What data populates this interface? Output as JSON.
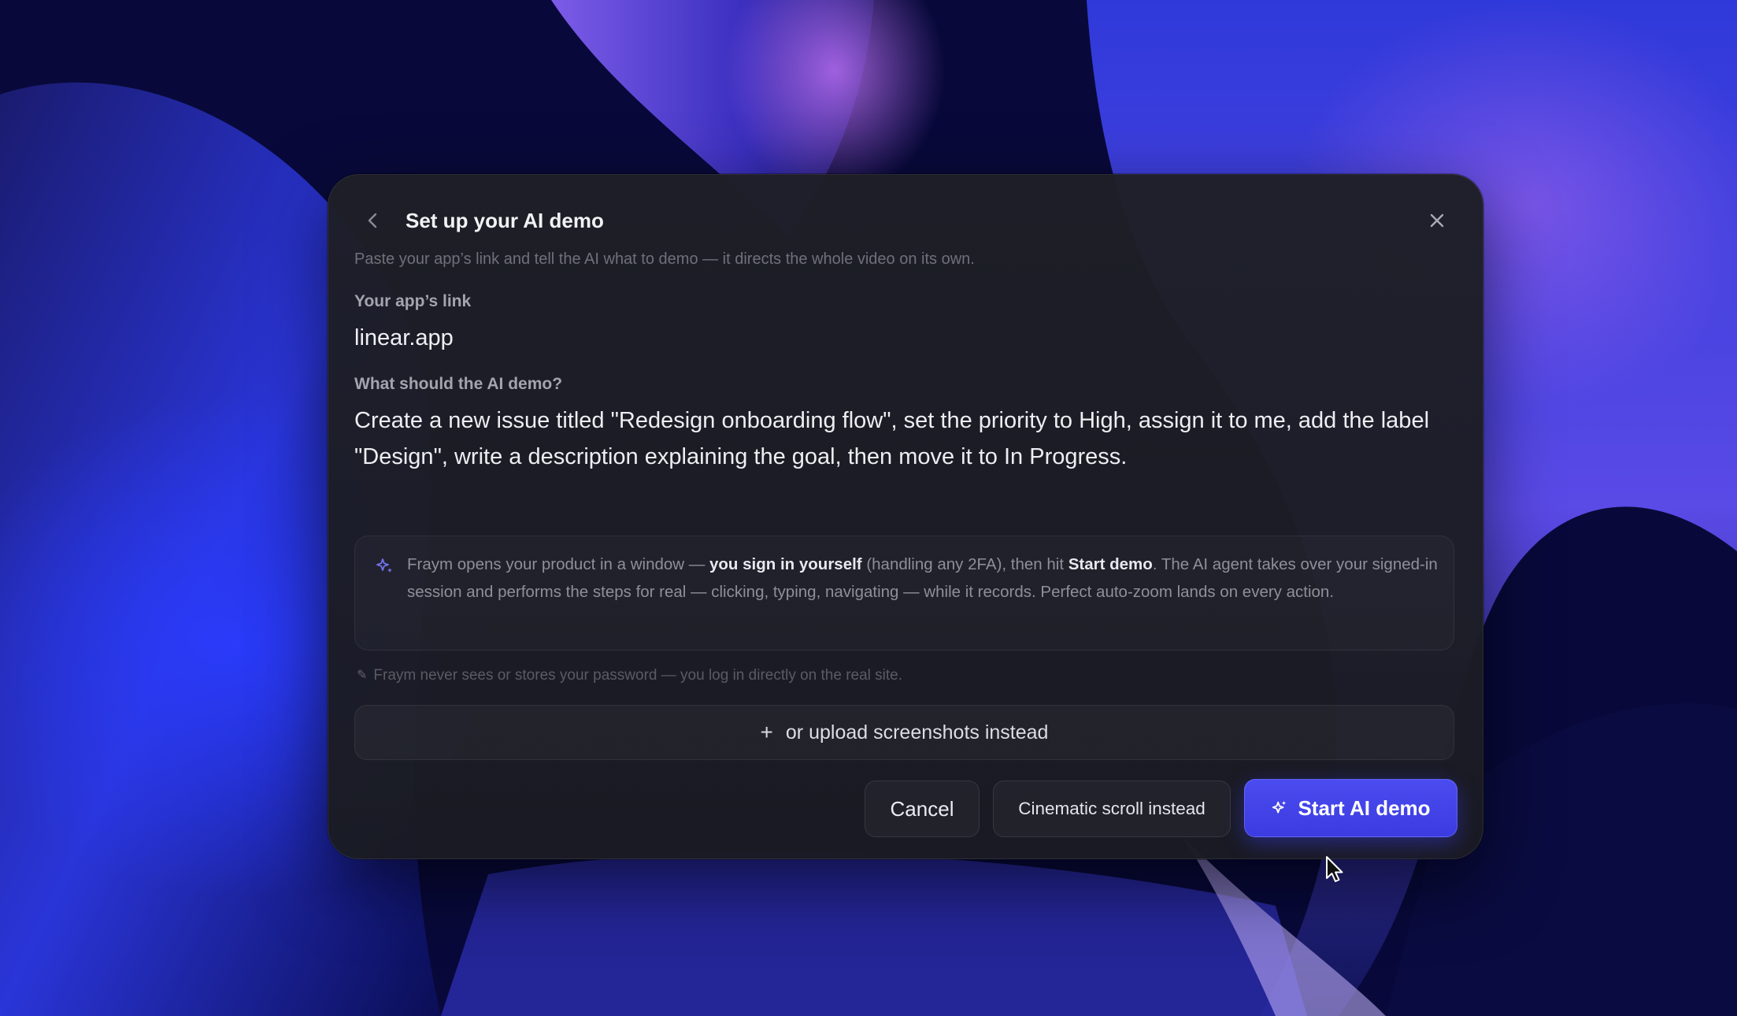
{
  "dialog": {
    "title": "Set up your AI demo",
    "subtitle": "Paste your app’s link and tell the AI what to demo — it directs the whole video on its own.",
    "back_icon": "chevron-left-icon",
    "close_icon": "close-icon"
  },
  "form": {
    "link_label": "Your app’s link",
    "link_value": "linear.app",
    "prompt_label": "What should the AI demo?",
    "prompt_value": "Create a new issue titled \"Redesign onboarding flow\", set the priority to High, assign it to me, add the label \"Design\", write a description explaining the goal, then move it to In Progress."
  },
  "info": {
    "icon": "sparkle-icon",
    "part1": "Fraym opens your product in a window — ",
    "bold1": "you sign in yourself",
    "part2": " (handling any 2FA), then hit ",
    "bold2": "Start demo",
    "part3": ". The AI agent takes over your signed-in session and performs the steps for real — clicking, typing, navigating — while it records. Perfect auto-zoom lands on every action."
  },
  "privacy": {
    "icon": "pen-icon",
    "text": "Fraym never sees or stores your password — you log in directly on the real site."
  },
  "actions": {
    "upload_label": "or upload screenshots instead",
    "cancel_label": "Cancel",
    "cinematic_label": "Cinematic scroll instead",
    "start_label": "Start AI demo"
  },
  "colors": {
    "accent": "#4040e6",
    "dialog_bg": "#1e1f26",
    "background": "#0a0c2e"
  }
}
